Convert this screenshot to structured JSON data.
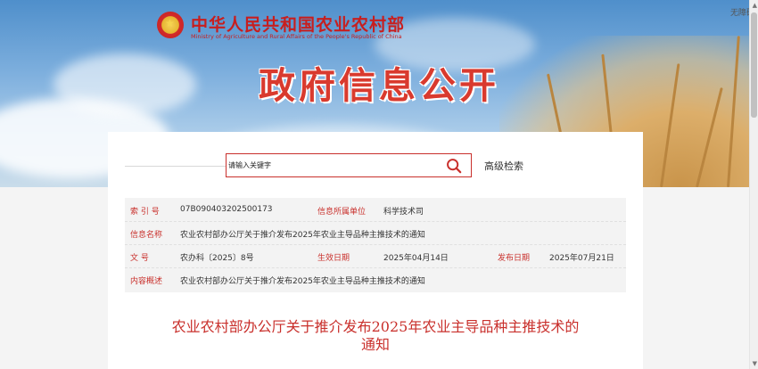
{
  "header": {
    "ministry_cn": "中华人民共和国农业农村部",
    "ministry_en": "Ministry of Agriculture and Rural Affairs  of the People's Republic of China",
    "accessibility_link": "无障碍",
    "page_title": "政府信息公开"
  },
  "search": {
    "placeholder": "请输入关键字",
    "advanced_label": "高级检索"
  },
  "info": {
    "index_label": "索 引 号",
    "index_value": "07B090403202500173",
    "dept_label": "信息所属单位",
    "dept_value": "科学技术司",
    "name_label": "信息名称",
    "name_value": "农业农村部办公厅关于推介发布2025年农业主导品种主推技术的通知",
    "docno_label": "文          号",
    "docno_value": "农办科〔2025〕8号",
    "effective_label": "生效日期",
    "effective_value": "2025年04月14日",
    "publish_label": "发布日期",
    "publish_value": "2025年07月21日",
    "summary_label": "内容概述",
    "summary_value": "农业农村部办公厅关于推介发布2025年农业主导品种主推技术的通知"
  },
  "document": {
    "title_line1": "农业农村部办公厅关于推介发布2025年农业主导品种主推技术的",
    "title_line2": "通知"
  },
  "colors": {
    "accent_red": "#c9302c",
    "title_red": "#d93a2e"
  },
  "icons": [
    "emblem-icon",
    "search-icon",
    "scroll-up-icon",
    "scroll-down-icon"
  ]
}
